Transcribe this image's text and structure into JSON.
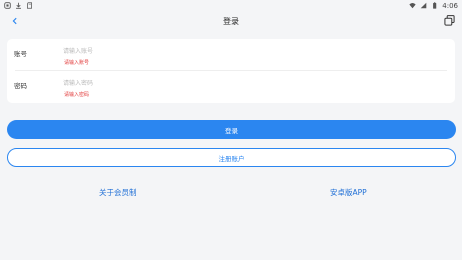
{
  "status_bar": {
    "time": "4:06",
    "left_icons": [
      "android-notification-icon",
      "download-icon",
      "sd-card-icon"
    ],
    "right_icons": [
      "wifi-icon",
      "signal-icon",
      "battery-icon"
    ]
  },
  "nav": {
    "title": "登录",
    "back_icon": "chevron-left-icon",
    "action_icon": "copy-icon"
  },
  "form": {
    "account": {
      "label": "账号",
      "placeholder": "请输入账号",
      "value": "",
      "error": "请输入账号"
    },
    "password": {
      "label": "密码",
      "placeholder": "请输入密码",
      "value": "",
      "error": "请输入密码"
    }
  },
  "buttons": {
    "login": "登录",
    "register": "注册账户"
  },
  "links": {
    "about_membership": "关于会员制",
    "android_app": "安卓版APP"
  },
  "colors": {
    "accent": "#2b86f0",
    "error": "#e23b3b",
    "link": "#1f6fd6",
    "background": "#f4f5f7"
  }
}
